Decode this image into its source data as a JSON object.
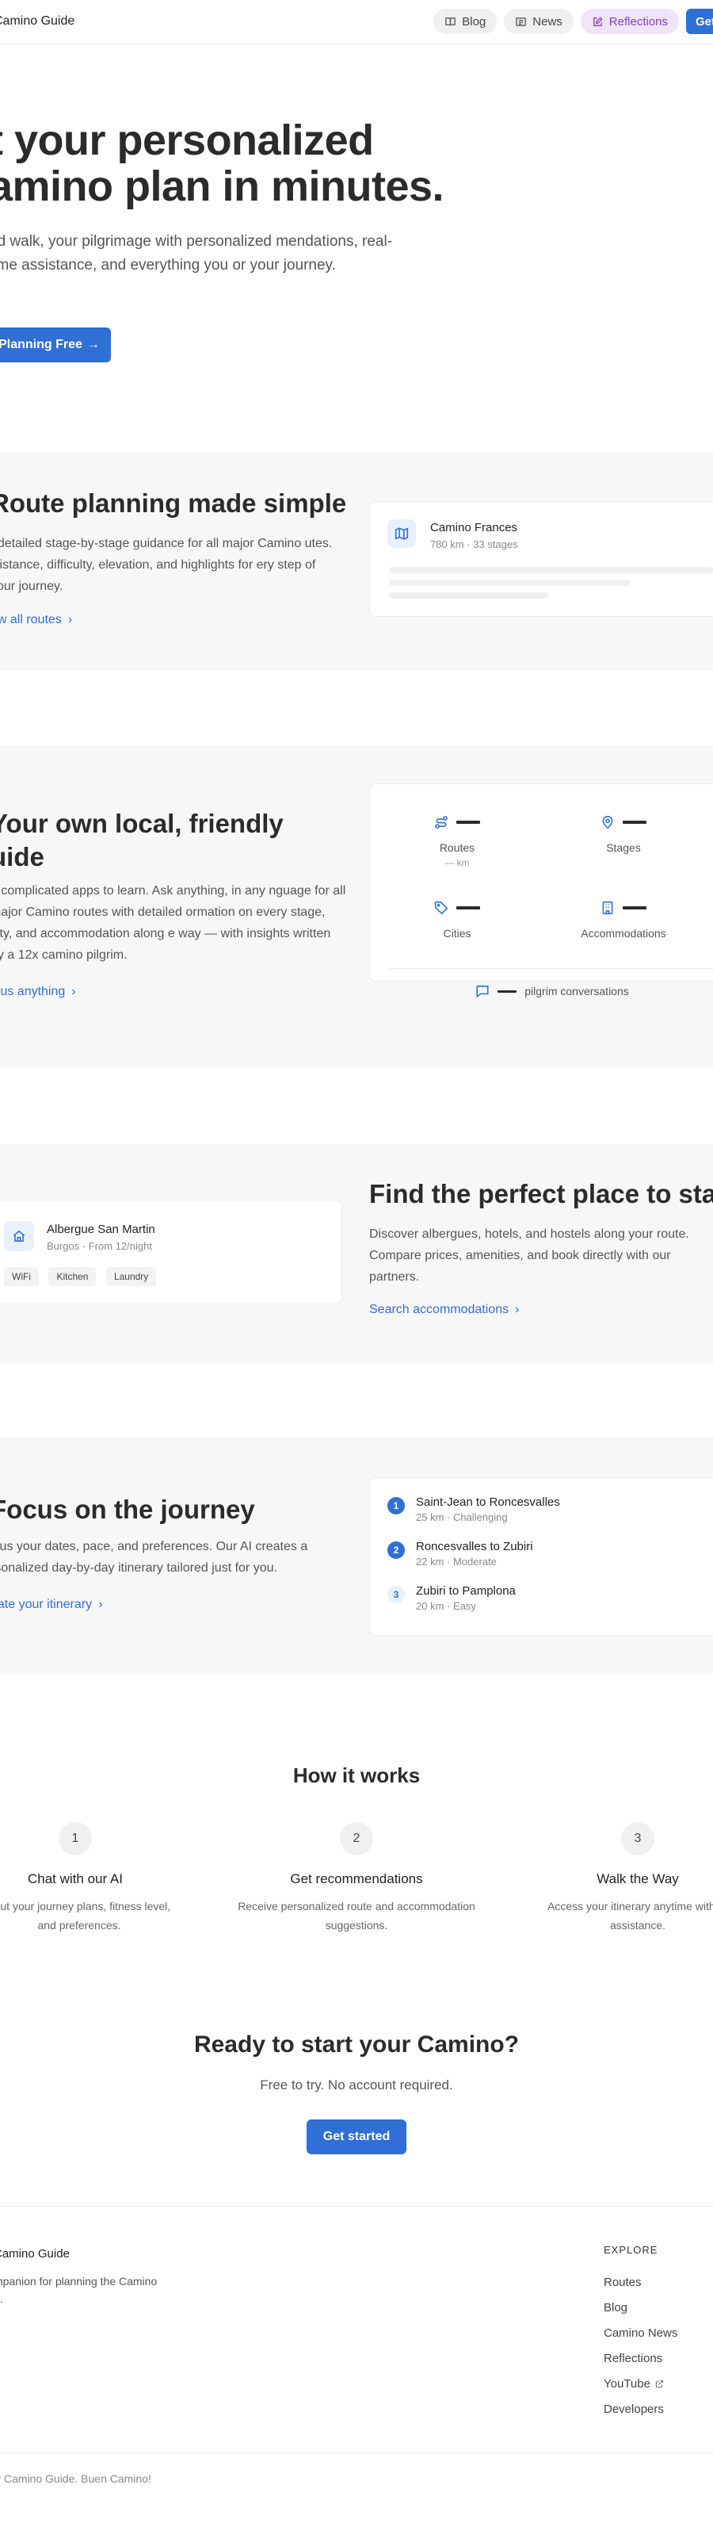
{
  "header": {
    "brand": "Camino Guide",
    "nav": [
      {
        "label": "Blog",
        "icon": "book-icon"
      },
      {
        "label": "News",
        "icon": "newspaper-icon"
      },
      {
        "label": "Reflections",
        "icon": "pencil-square-icon"
      }
    ],
    "cta_label": "Get started"
  },
  "hero": {
    "title_line1": "t your personalized",
    "title_line2": "amino plan in minutes.",
    "subtitle": "nd walk, your pilgrimage with personalized mendations, real-time assistance, and everything you or your journey.",
    "button_label": "Planning Free",
    "button_arrow": "→"
  },
  "routes": {
    "title": "Route planning made simple",
    "text": "t detailed stage-by-stage guidance for all major Camino utes. Distance, difficulty, elevation, and highlights for ery step of your journey.",
    "link": "ew all routes",
    "card": {
      "name": "Camino Frances",
      "meta": "780 km · 33 stages"
    }
  },
  "local": {
    "title": "Your own local, friendly uide",
    "text": "o complicated apps to learn. Ask anything, in any nguage for all major Camino routes with detailed ormation on every stage, city, and accommodation along e way — with insights written by a 12x camino pilgrim.",
    "link": "k us anything",
    "stats": [
      {
        "label": "Routes",
        "sub": "— km",
        "icon": "route-icon"
      },
      {
        "label": "Stages",
        "sub": "",
        "icon": "map-pin-icon"
      },
      {
        "label": "Cities",
        "sub": "",
        "icon": "tag-icon"
      },
      {
        "label": "Accommodations",
        "sub": "",
        "icon": "building-icon"
      }
    ],
    "conversations": "pilgrim conversations"
  },
  "accommodation": {
    "title": "Find the perfect place to stay",
    "text": "Discover albergues, hotels, and hostels along your route. Compare prices, amenities, and book directly with our partners.",
    "link": "Search accommodations",
    "card": {
      "name": "Albergue San Martin",
      "meta": "Burgos · From 12/night",
      "tags": [
        "WiFi",
        "Kitchen",
        "Laundry"
      ]
    }
  },
  "journey": {
    "title": "Focus on the journey",
    "text": "ll us your dates, pace, and preferences. Our AI creates a rsonalized day-by-day itinerary tailored just for you.",
    "link": "eate your itinerary",
    "steps": [
      {
        "num": "1",
        "name": "Saint-Jean to Roncesvalles",
        "meta": "25 km · Challenging"
      },
      {
        "num": "2",
        "name": "Roncesvalles to Zubiri",
        "meta": "22 km · Moderate"
      },
      {
        "num": "3",
        "name": "Zubiri to Pamplona",
        "meta": "20 km · Easy"
      }
    ]
  },
  "how": {
    "title": "How it works",
    "steps": [
      {
        "num": "1",
        "name": "Chat with our AI",
        "text": "bout your journey plans, fitness level, and preferences."
      },
      {
        "num": "2",
        "name": "Get recommendations",
        "text": "Receive personalized route and accommodation suggestions."
      },
      {
        "num": "3",
        "name": "Walk the Way",
        "text": "Access your itinerary anytime with re assistance."
      }
    ]
  },
  "ready": {
    "title": "Ready to start your Camino?",
    "subtitle": "Free to try. No account required.",
    "button_label": "Get started"
  },
  "footer": {
    "brand": "Camino Guide",
    "description": "mpanion for planning the Camino o.",
    "explore_heading": "EXPLORE",
    "links": [
      "Routes",
      "Blog",
      "Camino News",
      "Reflections",
      "YouTube",
      "Developers"
    ],
    "copyright": "y Camino Guide. Buen Camino!"
  },
  "colors": {
    "accent": "#2f6fd6",
    "reflections": "#8a3cc4",
    "band": "#f7f7f7"
  }
}
